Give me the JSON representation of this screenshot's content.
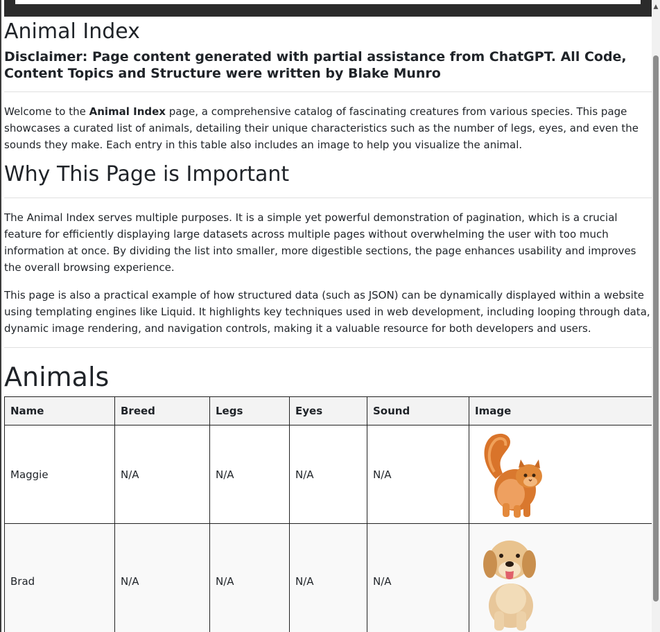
{
  "header": {
    "title": "Animal Index",
    "disclaimer": "Disclaimer: Page content generated with partial assistance from ChatGPT. All Code, Content Topics and Structure were written by Blake Munro"
  },
  "intro": {
    "prefix": "Welcome to the ",
    "bold": "Animal Index",
    "suffix": " page, a comprehensive catalog of fascinating creatures from various species. This page showcases a curated list of animals, detailing their unique characteristics such as the number of legs, eyes, and even the sounds they make. Each entry in this table also includes an image to help you visualize the animal."
  },
  "why": {
    "heading": "Why This Page is Important",
    "paragraph1": "The Animal Index serves multiple purposes. It is a simple yet powerful demonstration of pagination, which is a crucial feature for efficiently displaying large datasets across multiple pages without overwhelming the user with too much information at once. By dividing the list into smaller, more digestible sections, the page enhances usability and improves the overall browsing experience.",
    "paragraph2": "This page is also a practical example of how structured data (such as JSON) can be dynamically displayed within a website using templating engines like Liquid. It highlights key techniques used in web development, including looping through data, dynamic image rendering, and navigation controls, making it a valuable resource for both developers and users."
  },
  "animals": {
    "heading": "Animals",
    "columns": [
      "Name",
      "Breed",
      "Legs",
      "Eyes",
      "Sound",
      "Image"
    ],
    "rows": [
      {
        "name": "Maggie",
        "breed": "N/A",
        "legs": "N/A",
        "eyes": "N/A",
        "sound": "N/A",
        "image": "orange-persian-cat"
      },
      {
        "name": "Brad",
        "breed": "N/A",
        "legs": "N/A",
        "eyes": "N/A",
        "sound": "N/A",
        "image": "golden-retriever-puppy"
      }
    ]
  },
  "colors": {
    "text": "#1f2328",
    "table_header_bg": "#f3f3f3",
    "border": "#222222",
    "top_bar": "#2b2b2b"
  }
}
